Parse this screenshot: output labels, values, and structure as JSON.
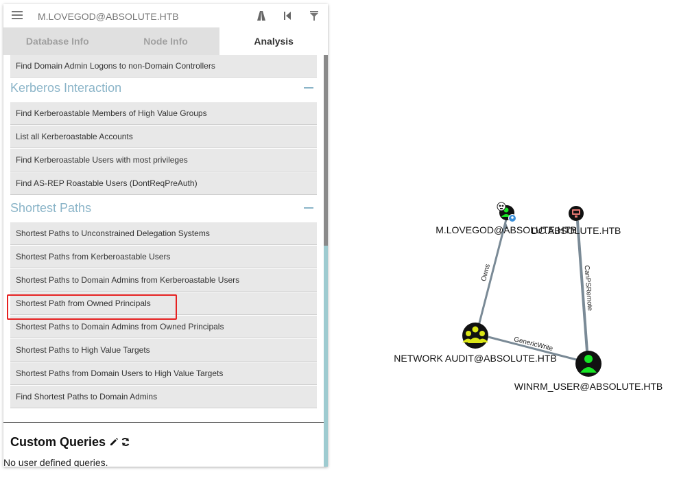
{
  "header": {
    "search_value": "M.LOVEGOD@ABSOLUTE.HTB"
  },
  "tabs": [
    {
      "label": "Database Info"
    },
    {
      "label": "Node Info"
    },
    {
      "label": "Analysis",
      "active": true
    }
  ],
  "analysis": {
    "top_partial_item": "Find Domain Admin Logons to non-Domain Controllers",
    "sections": [
      {
        "title": "Kerberos Interaction",
        "items": [
          "Find Kerberoastable Members of High Value Groups",
          "List all Kerberoastable Accounts",
          "Find Kerberoastable Users with most privileges",
          "Find AS-REP Roastable Users (DontReqPreAuth)"
        ]
      },
      {
        "title": "Shortest Paths",
        "items": [
          "Shortest Paths to Unconstrained Delegation Systems",
          "Shortest Paths from Kerberoastable Users",
          "Shortest Paths to Domain Admins from Kerberoastable Users",
          "Shortest Path from Owned Principals",
          "Shortest Paths to Domain Admins from Owned Principals",
          "Shortest Paths to High Value Targets",
          "Shortest Paths from Domain Users to High Value Targets",
          "Find Shortest Paths to Domain Admins"
        ]
      }
    ],
    "highlighted_item": "Shortest Path from Owned Principals",
    "custom_queries": {
      "title": "Custom Queries",
      "empty_text": "No user defined queries."
    }
  },
  "graph": {
    "nodes": {
      "user_mlovegod": {
        "label": "M.LOVEGOD@ABSOLUTE.HTB",
        "icon": "user-icon",
        "owned": true
      },
      "computer_dc": {
        "label": "DC.ABSOLUTE.HTB",
        "icon": "computer-icon"
      },
      "group_network_audit": {
        "label": "NETWORK AUDIT@ABSOLUTE.HTB",
        "icon": "group-icon"
      },
      "user_winrm": {
        "label": "WINRM_USER@ABSOLUTE.HTB",
        "icon": "user-icon"
      }
    },
    "edges": {
      "owns": {
        "label": "Owns"
      },
      "generic_write": {
        "label": "GenericWrite"
      },
      "can_ps_remote": {
        "label": "CanPSRemote"
      }
    },
    "colors": {
      "user": "#17e625",
      "computer": "#e67873",
      "group": "#dbe617",
      "edge": "#7a8a96",
      "highlight": "#e62020"
    }
  }
}
